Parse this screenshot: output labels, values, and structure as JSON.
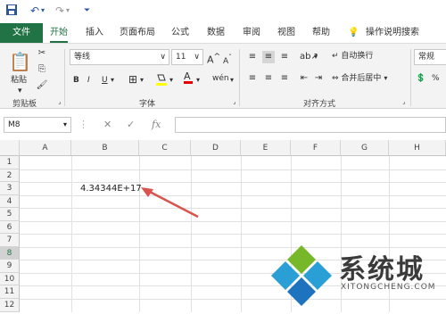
{
  "quick_access": {
    "save_icon": "save-icon",
    "undo_icon": "undo-icon",
    "redo_icon": "redo-icon",
    "customize_icon": "customize-qat-icon"
  },
  "tabs": [
    {
      "label": "文件"
    },
    {
      "label": "开始"
    },
    {
      "label": "插入"
    },
    {
      "label": "页面布局"
    },
    {
      "label": "公式"
    },
    {
      "label": "数据"
    },
    {
      "label": "审阅"
    },
    {
      "label": "视图"
    },
    {
      "label": "帮助"
    }
  ],
  "tell_me": "操作说明搜索",
  "ribbon": {
    "clipboard": {
      "paste": "粘贴",
      "group": "剪贴板"
    },
    "font": {
      "name": "等线",
      "size": "11",
      "group": "字体",
      "bold": "B",
      "italic": "I",
      "underline": "U",
      "grow": "A",
      "shrink": "A"
    },
    "alignment": {
      "wrap": "自动换行",
      "merge": "合并后居中",
      "group": "对齐方式"
    },
    "number": {
      "format": "常规"
    }
  },
  "formula_bar": {
    "name_box": "M8",
    "cancel": "✕",
    "enter": "✓",
    "fx": "fx",
    "content": ""
  },
  "sheet": {
    "columns": [
      "A",
      "B",
      "C",
      "D",
      "E",
      "F",
      "G",
      "H"
    ],
    "rows": [
      "1",
      "2",
      "3",
      "4",
      "5",
      "6",
      "7",
      "8",
      "9",
      "10",
      "11",
      "12"
    ],
    "active_cell": "M8",
    "cells": [
      {
        "ref": "B3",
        "value": "4.34344E+17"
      }
    ]
  },
  "watermark": {
    "title": "系统城",
    "subtitle": "XITONGCHENG.COM"
  },
  "colors": {
    "accent": "#217346",
    "arrow": "#d9534f"
  }
}
